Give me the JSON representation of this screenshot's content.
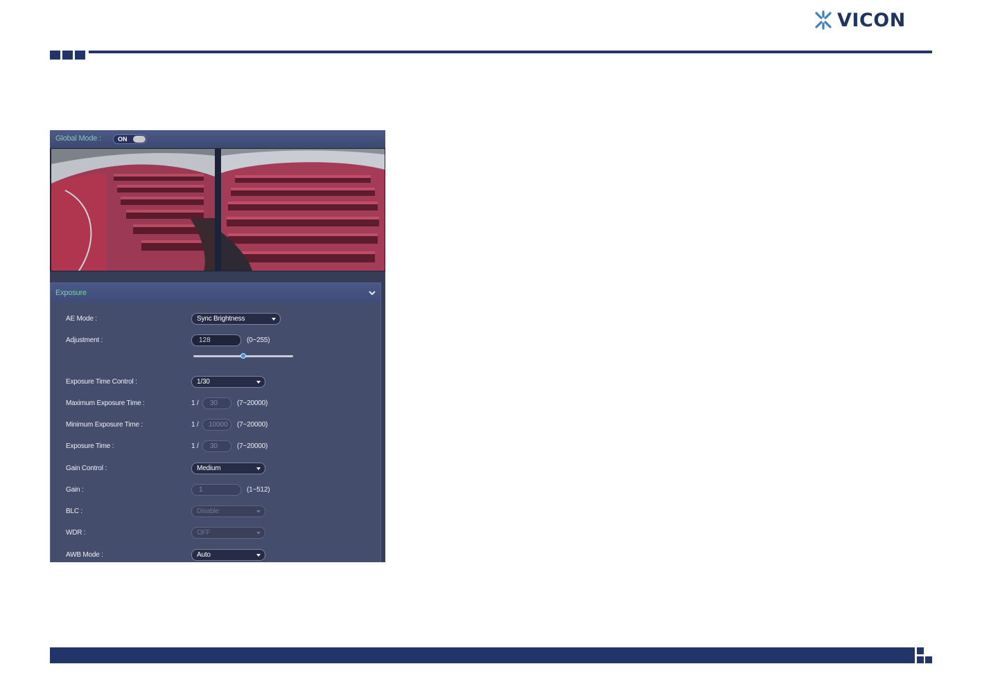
{
  "brand": {
    "name": "VICON"
  },
  "global_mode": {
    "label": "Global Mode :",
    "toggle_state": "ON"
  },
  "camera_views": [
    {
      "name": "view-left",
      "icon": "camera-feed-auditorium"
    },
    {
      "name": "view-right",
      "icon": "camera-feed-auditorium"
    }
  ],
  "exposure": {
    "title": "Exposure",
    "ae_mode": {
      "label": "AE Mode :",
      "value": "Sync Brightness"
    },
    "adjustment": {
      "label": "Adjustment :",
      "value": "128",
      "range": "(0~255)",
      "slider_fraction": 0.5
    },
    "exposure_time_control": {
      "label": "Exposure Time Control :",
      "value": "1/30"
    },
    "max_exposure_time": {
      "label": "Maximum Exposure Time :",
      "prefix": "1 /",
      "value": "30",
      "range": "(7~20000)"
    },
    "min_exposure_time": {
      "label": "Minimum Exposure Time :",
      "prefix": "1 /",
      "value": "10000",
      "range": "(7~20000)"
    },
    "exposure_time": {
      "label": "Exposure Time :",
      "prefix": "1 /",
      "value": "30",
      "range": "(7~20000)"
    },
    "gain_control": {
      "label": "Gain Control :",
      "value": "Medium"
    },
    "gain": {
      "label": "Gain :",
      "value": "1",
      "range": "(1~512)"
    },
    "blc": {
      "label": "BLC :",
      "value": "Disable"
    },
    "wdr": {
      "label": "WDR :",
      "value": "OFF"
    },
    "awb_mode": {
      "label": "AWB Mode :",
      "value": "Auto"
    }
  },
  "colors": {
    "brand_navy": "#233468",
    "accent_green": "#79d0a6",
    "panel_bg": "#454d6d"
  }
}
